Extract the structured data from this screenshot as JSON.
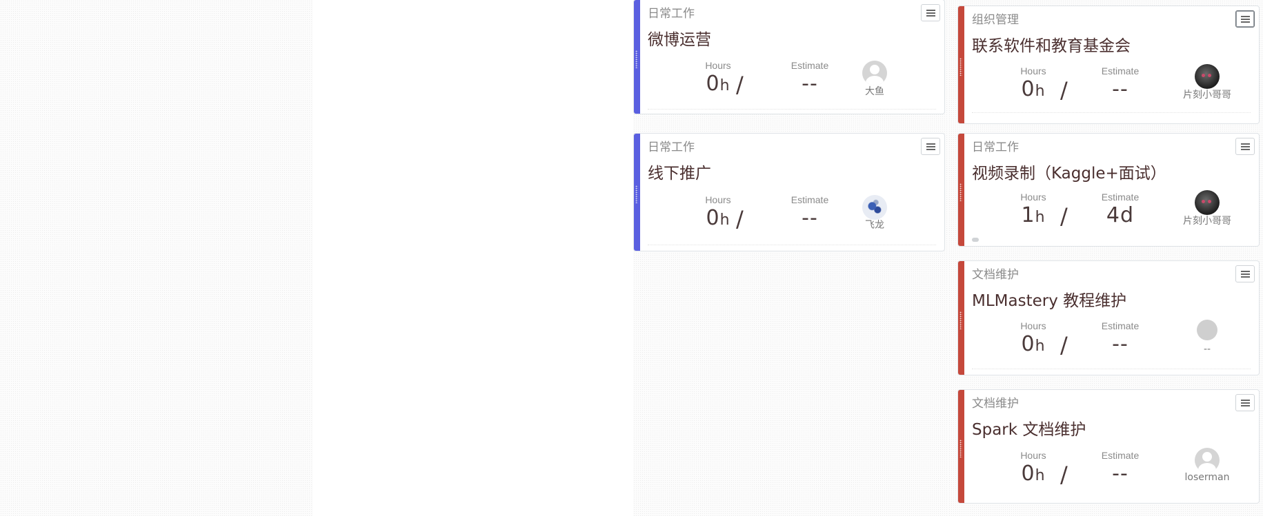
{
  "colors": {
    "blue_stripe": "#5a5fe0",
    "red_stripe": "#c5483b"
  },
  "labels": {
    "hours": "Hours",
    "estimate": "Estimate",
    "slash": "/"
  },
  "columns": {
    "middle": [
      {
        "category": "日常工作",
        "title": "微博运营",
        "hours": "0",
        "hours_unit": "h",
        "estimate": "--",
        "estimate_unit": "",
        "owner": "大鱼",
        "avatar": "default-avatar-icon"
      },
      {
        "category": "日常工作",
        "title": "线下推广",
        "hours": "0",
        "hours_unit": "h",
        "estimate": "--",
        "estimate_unit": "",
        "owner": "飞龙",
        "avatar": "flower-avatar-icon"
      }
    ],
    "right": [
      {
        "category": "组织管理",
        "title": "联系软件和教育基金会",
        "hours": "0",
        "hours_unit": "h",
        "estimate": "--",
        "estimate_unit": "",
        "owner": "片刻小哥哥",
        "avatar": "dark-avatar-icon"
      },
      {
        "category": "日常工作",
        "title": "视频录制（Kaggle+面试）",
        "hours": "1",
        "hours_unit": "h",
        "estimate": "4d",
        "estimate_unit": "",
        "owner": "片刻小哥哥",
        "avatar": "dark-avatar-icon",
        "progress_fraction": 0.03
      },
      {
        "category": "文档维护",
        "title": "MLMastery 教程维护",
        "hours": "0",
        "hours_unit": "h",
        "estimate": "--",
        "estimate_unit": "",
        "owner": "--",
        "avatar": "placeholder-avatar-icon"
      },
      {
        "category": "文档维护",
        "title": "Spark 文档维护",
        "hours": "0",
        "hours_unit": "h",
        "estimate": "--",
        "estimate_unit": "",
        "owner": "loserman",
        "avatar": "default-avatar-icon"
      }
    ]
  }
}
